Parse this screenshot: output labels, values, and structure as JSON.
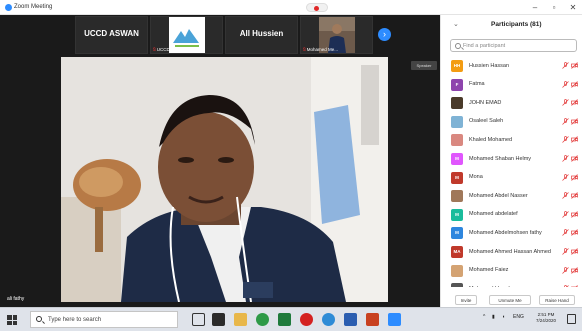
{
  "app": {
    "title": "Zoom Meeting"
  },
  "strip": {
    "thumbs": [
      {
        "name": "UCCD ASWAN",
        "label": ""
      },
      {
        "name": "",
        "label": "UCCD Aswan"
      },
      {
        "name": "All Hussien",
        "label": ""
      },
      {
        "name": "",
        "label": "Mohamed Me..."
      }
    ]
  },
  "meeting": {
    "speaker_tag": "Speaker",
    "video_label": "ali fathy"
  },
  "participants": {
    "title": "Participants (81)",
    "search_placeholder": "Find a participant",
    "items": [
      {
        "initials": "HH",
        "name": "Hussien Hassan",
        "color": "#f39c12"
      },
      {
        "initials": "F",
        "name": "Fatma",
        "color": "#8e44ad"
      },
      {
        "initials": "",
        "name": "JOHN EMAD",
        "color": "#4a3a2a"
      },
      {
        "initials": "",
        "name": "Osaleel Saleh",
        "color": "#7fb3d5"
      },
      {
        "initials": "",
        "name": "Khaled Mohamed",
        "color": "#d98880"
      },
      {
        "initials": "M",
        "name": "Mohamed Shaban Helmy",
        "color": "#e056fd"
      },
      {
        "initials": "M",
        "name": "Mona",
        "color": "#c0392b"
      },
      {
        "initials": "",
        "name": "Mohamed Abdel Nasser",
        "color": "#a0785a"
      },
      {
        "initials": "M",
        "name": "Mohamed abdelatef",
        "color": "#1abc9c"
      },
      {
        "initials": "M",
        "name": "Mohamed Abdelmohsen fathy",
        "color": "#2e86de"
      },
      {
        "initials": "MA",
        "name": "Mohamed Ahmed Hassan Ahmed",
        "color": "#c0392b"
      },
      {
        "initials": "",
        "name": "Mohamed Faiez",
        "color": "#d4a373"
      },
      {
        "initials": "",
        "name": "Mohamed Hamdy",
        "color": "#555555"
      }
    ],
    "footer": {
      "invite": "Invite",
      "unmute_all": "Unmute Me",
      "reclaim": "Raise Hand"
    }
  },
  "taskbar": {
    "search_placeholder": "Type here to search",
    "language": "ENG",
    "time": "2:51 PM",
    "date": "7/24/2020"
  },
  "colors": {
    "accent": "#2d8cff",
    "muted_red": "#e33b3b"
  }
}
